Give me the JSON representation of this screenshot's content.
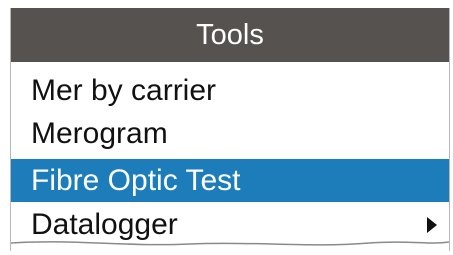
{
  "menu": {
    "title": "Tools",
    "items": [
      {
        "label": "Mer by carrier",
        "selected": false,
        "has_submenu": false
      },
      {
        "label": "Merogram",
        "selected": false,
        "has_submenu": false
      },
      {
        "label": "Fibre Optic Test",
        "selected": true,
        "has_submenu": false
      },
      {
        "label": "Datalogger",
        "selected": false,
        "has_submenu": true,
        "submenu_icon": "arrow-right-icon"
      }
    ]
  },
  "colors": {
    "header_bg": "#555250",
    "header_text": "#ffffff",
    "selected_bg": "#1d7dbb",
    "selected_text": "#ffffff",
    "item_text": "#111111"
  }
}
